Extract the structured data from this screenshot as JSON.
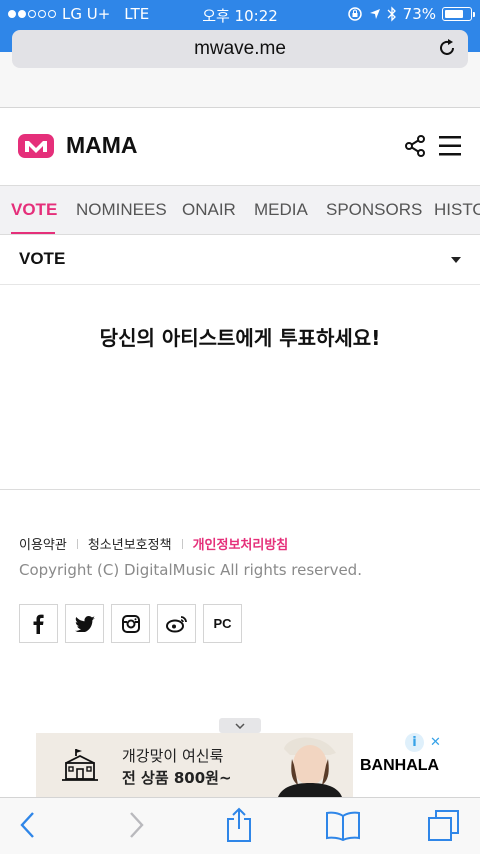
{
  "status_bar": {
    "carrier": "LG U+",
    "network": "LTE",
    "time": "오후 10:22",
    "battery": "73%",
    "battery_level": 0.73,
    "signal_bars_filled": 2,
    "signal_bars_total": 5
  },
  "browser": {
    "url": "mwave.me"
  },
  "header": {
    "brand": "MAMA",
    "accent_color": "#e52f7a"
  },
  "tabs": [
    {
      "label": "VOTE",
      "active": true
    },
    {
      "label": "NOMINEES",
      "active": false
    },
    {
      "label": "ONAIR",
      "active": false
    },
    {
      "label": "MEDIA",
      "active": false
    },
    {
      "label": "SPONSORS",
      "active": false
    },
    {
      "label": "HISTO",
      "active": false
    }
  ],
  "vote_select": {
    "selected": "VOTE"
  },
  "main": {
    "headline": "당신의 아티스트에게 투표하세요!"
  },
  "footer": {
    "links": [
      "이용약관",
      "청소년보호정책",
      "개인정보처리방침"
    ],
    "copyright": "Copyright (C) DigitalMusic All rights reserved.",
    "social": [
      {
        "icon": "facebook-icon"
      },
      {
        "icon": "twitter-icon"
      },
      {
        "icon": "instagram-icon"
      },
      {
        "icon": "weibo-icon"
      },
      {
        "label": "PC"
      }
    ]
  },
  "ad": {
    "line1": "개강맞이 여신룩",
    "line2": "전 상품 800원~",
    "brand": "BANHALA",
    "info": "i",
    "close": "✕"
  },
  "toolbar": {
    "icons": [
      "back-icon",
      "forward-icon",
      "share-icon",
      "bookmarks-icon",
      "tabs-icon"
    ]
  }
}
